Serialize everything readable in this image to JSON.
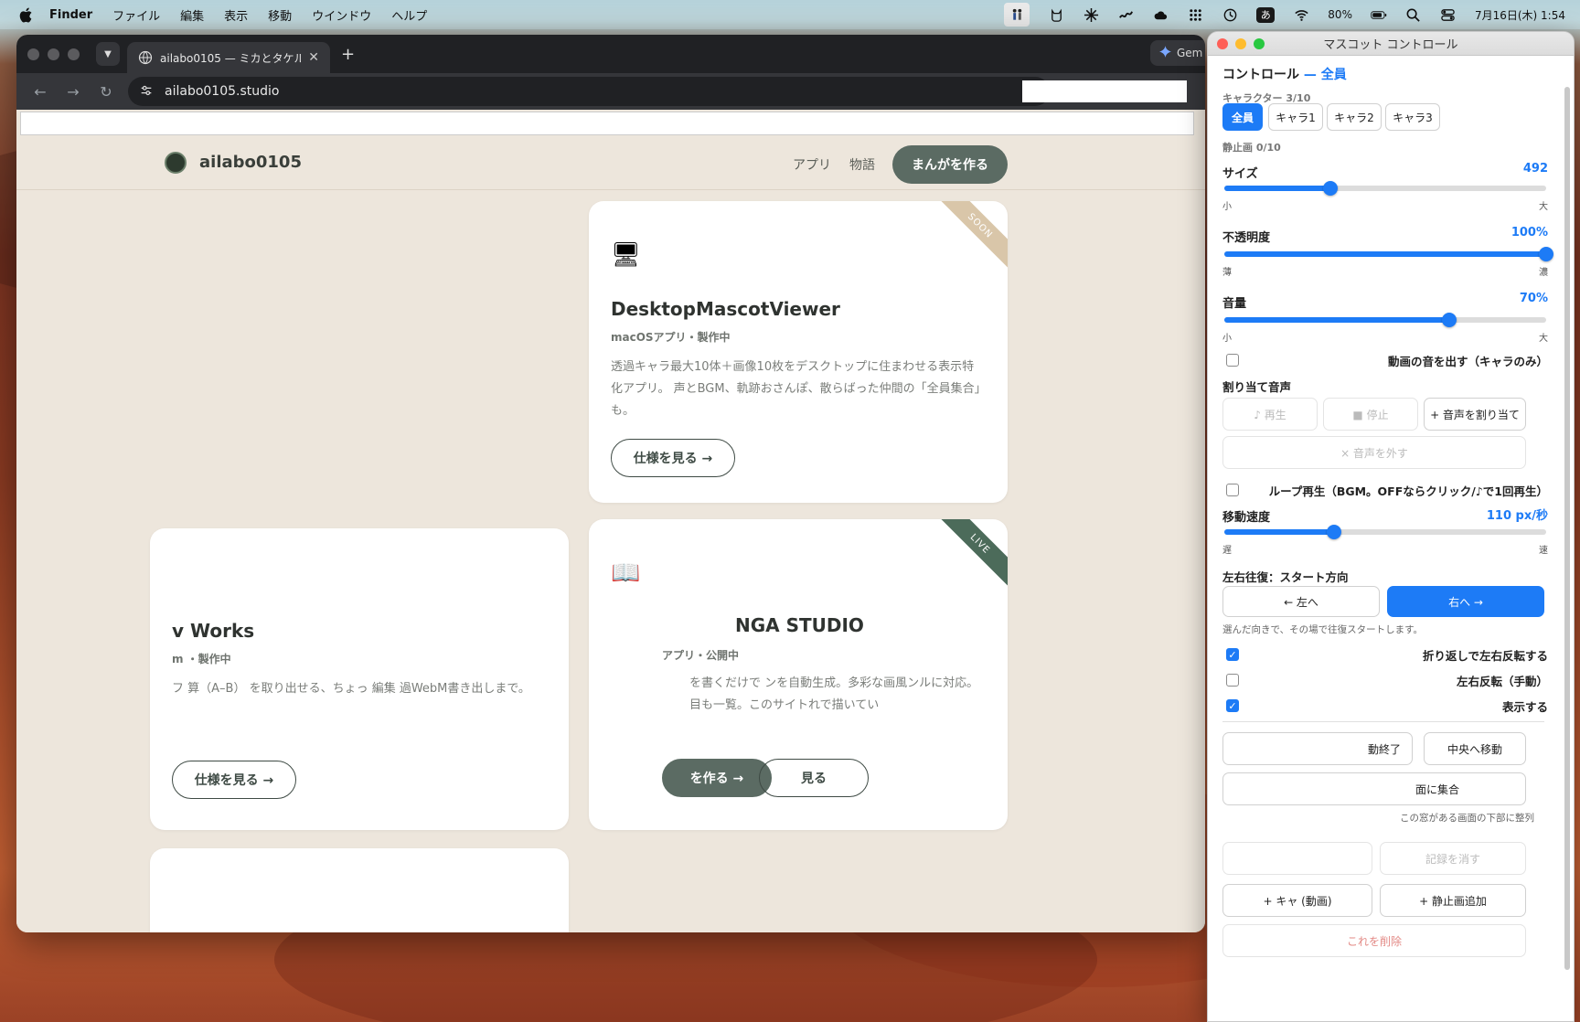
{
  "menubar": {
    "apple": "",
    "items": [
      "Finder",
      "ファイル",
      "編集",
      "表示",
      "移動",
      "ウインドウ",
      "ヘルプ"
    ],
    "ime": "あ",
    "battery": "80%",
    "datetime": "7月16日(木) 1:54"
  },
  "browser": {
    "tab_title": "ailabo0105 — ミカとタケルと、",
    "new_tab": "+",
    "gemini_label": "Gem",
    "url": "ailabo0105.studio"
  },
  "site": {
    "name": "ailabo0105",
    "nav": [
      "アプリ",
      "物語"
    ],
    "cta": "まんがを作る"
  },
  "cards": [
    {
      "ribbon": "SOON",
      "icon": "🖥",
      "title": "DesktopMascotViewer",
      "subtitle": "macOSアプリ・製作中",
      "desc": "透過キャラ最大10体＋画像10枚をデスクトップに住まわせる表示特化アプリ。 声とBGM、軌跡おさんぽ、散らばった仲間の「全員集合」も。",
      "button": "仕様を見る →"
    },
    {
      "ribbon": "",
      "icon": "",
      "title": "v      Works",
      "subtitle": "m       ・製作中",
      "desc": "フ        算（A–B）         を取り出せる、ちょっ    編集         過WebM書き出しまで。",
      "button": "仕様を見る →"
    },
    {
      "ribbon": "LIVE",
      "icon": "📖",
      "title": "NGA STUDIO",
      "subtitle": "アプリ・公開中",
      "desc": "を書くだけで        ンを自動生成。多彩な画風ンルに対応。        目も一覧。このサイトれで描いてい",
      "buttons": [
        "を作る →",
        "見る"
      ]
    }
  ],
  "panel": {
    "window_title": "マスコット コントロール",
    "heading": "コントロール",
    "heading_accent": "— 全員",
    "character_label": "キャラクター 3/10",
    "char_tabs": [
      "全員",
      "キャラ1",
      "キャラ2",
      "キャラ3"
    ],
    "still_label": "静止画 0/10",
    "sliders": [
      {
        "label": "サイズ",
        "value": "492",
        "level": 0.33,
        "min_label": "小",
        "max_label": "大"
      },
      {
        "label": "不透明度",
        "value": "100%",
        "level": 1.0,
        "min_label": "薄",
        "max_label": "濃"
      },
      {
        "label": "音量",
        "value": "70%",
        "level": 0.7,
        "min_label": "小",
        "max_label": "大"
      }
    ],
    "video_sound": "動画の音を出す（キャラのみ）",
    "assign_heading": "割り当て音声",
    "audio_buttons": [
      "♪ 再生",
      "■ 停止",
      "+ 音声を割り当て"
    ],
    "remove_audio": "× 音声を外す",
    "loop_label": "ループ再生（BGM。OFFならクリック/♪で1回再生）",
    "speed": {
      "label": "移動速度",
      "value": "110 px/秒",
      "level": 0.34,
      "min_label": "遅",
      "max_label": "速"
    },
    "direction_heading": "左右往復：スタート方向",
    "dir_left": "← 左へ",
    "dir_right": "右へ →",
    "direction_note": "選んだ向きで、その場で往復スタートします。",
    "checks": [
      {
        "label": "折り返しで左右反転する",
        "checked": true
      },
      {
        "label": "左右反転（手動）",
        "checked": false
      },
      {
        "label": "表示する",
        "checked": true
      }
    ],
    "end_btn": "動終了",
    "center_btn": "中央へ移動",
    "gather_btn": "面に集合",
    "gather_note": "この窓がある画面の下部に整列",
    "disabled_left": "",
    "disabled_right": "記録を消す",
    "add_char": "+ キャ      (動画)",
    "add_image": "+ 静止画追加",
    "delete_btn": "これを削除"
  }
}
